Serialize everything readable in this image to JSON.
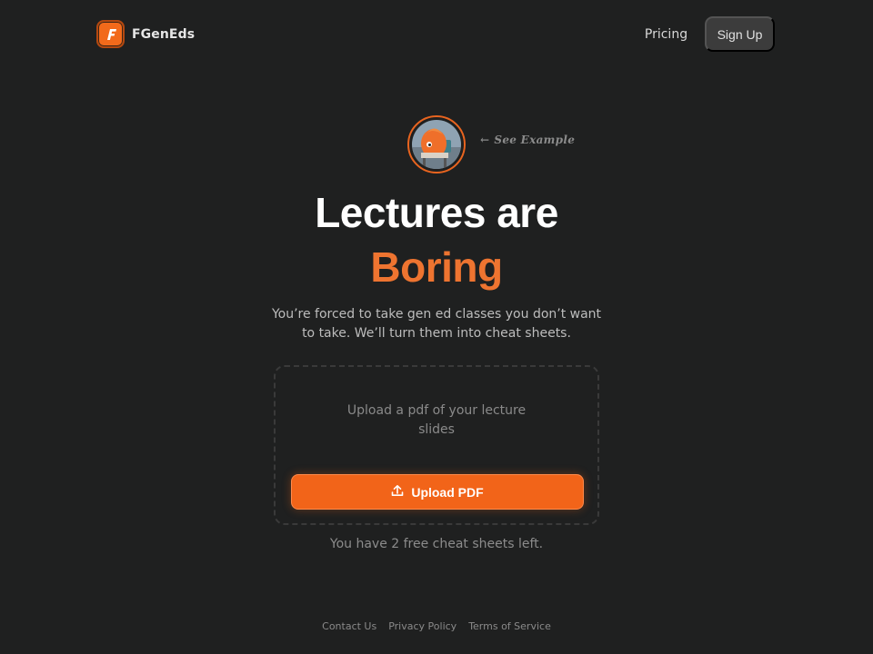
{
  "brand": {
    "name": "FGenEds",
    "logo_letter": "F",
    "logo_icon": "f-logo-icon"
  },
  "nav": {
    "pricing_label": "Pricing",
    "signup_label": "Sign Up"
  },
  "hero": {
    "example_label": "See Example",
    "example_arrow": "←",
    "avatar_icon": "orange-character-avatar",
    "headline_line1": "Lectures are",
    "headline_line2": "Boring",
    "subtitle": "You’re forced to take gen ed classes you don’t want to take. We’ll turn them into cheat sheets."
  },
  "upload": {
    "hint": "Upload a pdf of your lecture slides",
    "button_label": "Upload PDF",
    "button_icon": "upload-icon"
  },
  "credits_text": "You have 2 free cheat sheets left.",
  "footer": {
    "links": [
      "Contact Us",
      "Privacy Policy",
      "Terms of Service"
    ]
  },
  "colors": {
    "background": "#1f2020",
    "accent": "#f26419",
    "accent_text": "#ee7430",
    "signup_bg": "#3c3c3c"
  }
}
